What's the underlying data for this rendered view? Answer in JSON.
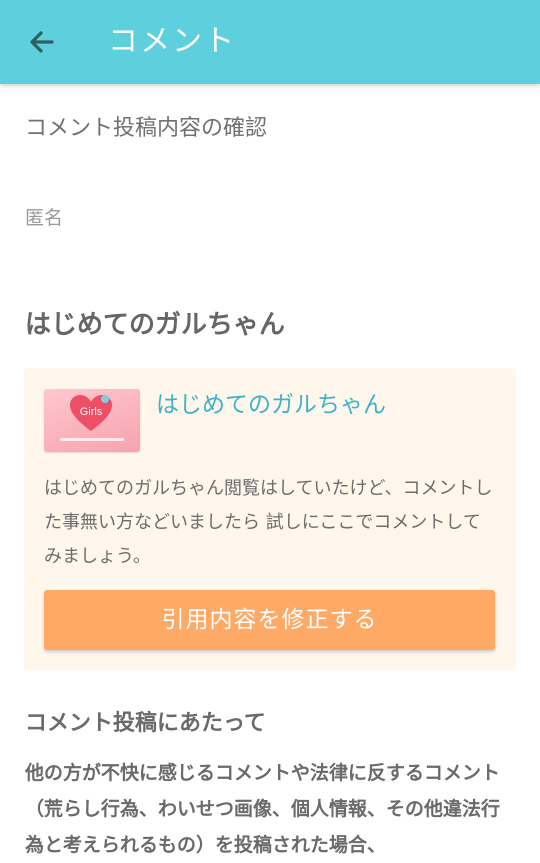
{
  "header": {
    "title": "コメント"
  },
  "confirm": {
    "section_title": "コメント投稿内容の確認",
    "author": "匿名",
    "headline": "はじめてのガルちゃん"
  },
  "quote": {
    "thumbnail_text": "Girls",
    "title": "はじめてのガルちゃん",
    "body": "はじめてのガルちゃん閲覧はしていたけど、コメントした事無い方などいましたら 試しにここでコメントしてみましょう。",
    "edit_button_label": "引用内容を修正する"
  },
  "rules": {
    "title": "コメント投稿にあたって",
    "body": "他の方が不快に感じるコメントや法律に反するコメント（荒らし行為、わいせつ画像、個人情報、その他違法行為と考えられるもの）を投稿された場合、"
  },
  "colors": {
    "appbar": "#5dcfdd",
    "button": "#fea965",
    "card": "#fff7ec",
    "link": "#3fb2c6"
  }
}
